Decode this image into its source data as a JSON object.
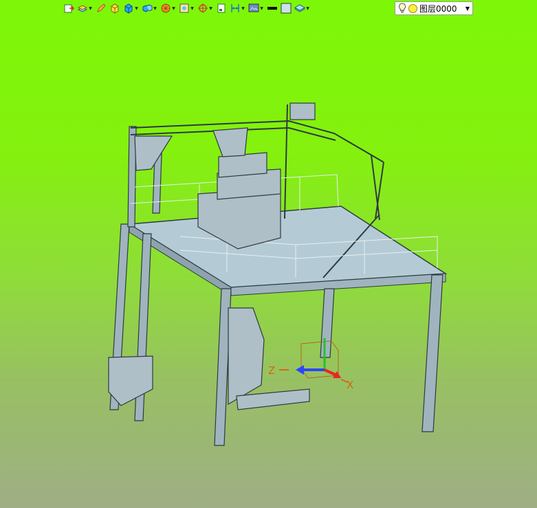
{
  "toolbar": {
    "items": [
      {
        "icon": "exit-sketch-icon",
        "dropdown": false
      },
      {
        "icon": "layers-stack-icon",
        "dropdown": true
      },
      {
        "icon": "pen-icon",
        "dropdown": false
      },
      {
        "icon": "box-yellow-icon",
        "dropdown": false
      },
      {
        "icon": "box-blue-icon",
        "dropdown": true
      },
      {
        "icon": "box-multi-icon",
        "dropdown": true
      },
      {
        "icon": "sphere-grid-icon",
        "dropdown": true
      },
      {
        "icon": "image-frame-icon",
        "dropdown": true
      },
      {
        "icon": "axis-target-icon",
        "dropdown": true
      },
      {
        "icon": "page-icon",
        "dropdown": false
      },
      {
        "icon": "dimension-icon",
        "dropdown": true
      },
      {
        "icon": "view-render-icon",
        "dropdown": true
      },
      {
        "icon": "line-weight-icon",
        "dropdown": false
      },
      {
        "icon": "fill-color-icon",
        "dropdown": false
      },
      {
        "icon": "material-layer-icon",
        "dropdown": true
      }
    ]
  },
  "layer_selector": {
    "value": "图层0000",
    "icons": [
      "bulb-icon",
      "sun-icon"
    ],
    "dropdown_icon": "chevron-down-icon"
  },
  "viewport": {
    "axis_labels": {
      "z": "Z",
      "x": "X"
    },
    "colors": {
      "steel": "#9fb4be",
      "platform": "#b4cbd6",
      "edge": "#2d3a40",
      "x_axis": "#e8281e",
      "y_axis": "#23c32a",
      "z_axis": "#2b45ff",
      "bbox": "#b5651d"
    }
  }
}
